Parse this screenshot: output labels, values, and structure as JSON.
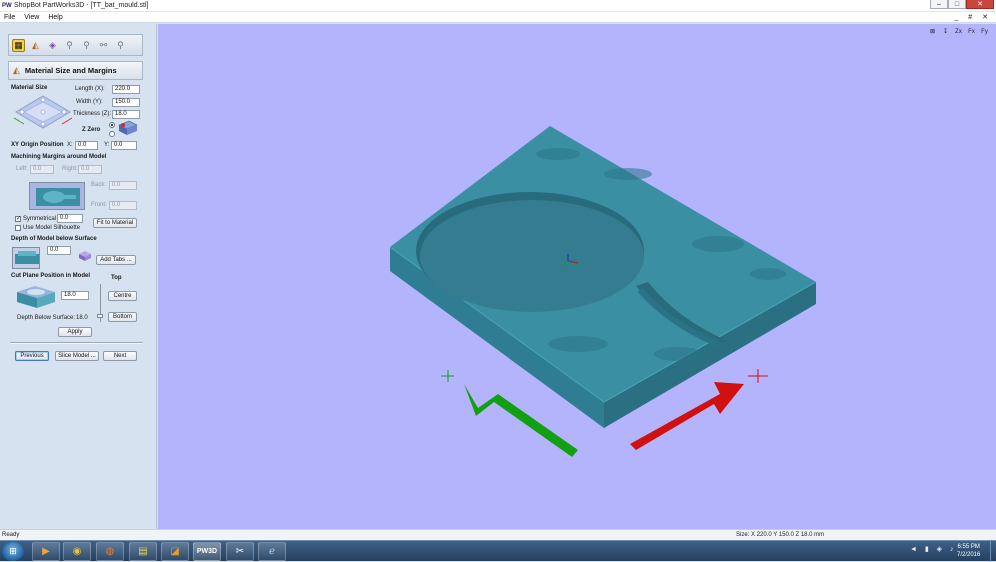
{
  "window": {
    "title": "ShopBot PartWorks3D - [TT_bat_mould.stl]",
    "app_icon": "pw3d-app-icon",
    "controls": [
      "–",
      "□",
      "✕"
    ]
  },
  "menu": {
    "items": [
      "File",
      "View",
      "Help"
    ],
    "mdi_controls": "_ # ✕"
  },
  "toolbar": {
    "icons": [
      "load-model-icon",
      "material-size-icon",
      "orient-model-icon",
      "toolpath-roughing-icon",
      "toolpath-finishing-icon",
      "preview-icon",
      "save-toolpath-icon"
    ]
  },
  "section": {
    "title": "Material Size and Margins",
    "icon": "material-size-icon"
  },
  "material_size": {
    "heading": "Material Size",
    "length_label": "Length (X):",
    "length_value": "220.0",
    "width_label": "Width (Y):",
    "width_value": "150.0",
    "thickness_label": "Thickness (Z):",
    "thickness_value": "18.0",
    "z_zero_label": "Z Zero"
  },
  "xy_origin": {
    "label": "XY Origin Position",
    "x_label": "X:",
    "x_value": "0.0",
    "y_label": "Y:",
    "y_value": "0.0"
  },
  "margins": {
    "heading": "Machining Margins around Model",
    "left_label": "Left:",
    "left_value": "0.0",
    "right_label": "Right:",
    "right_value": "0.0",
    "back_label": "Back:",
    "back_value": "0.0",
    "front_label": "Front:",
    "front_value": "0.0",
    "symmetrical_label": "Symmetrical",
    "symmetrical_checked": true,
    "symmetrical_value": "0.0",
    "use_silhouette_label": "Use Model Silhouette",
    "use_silhouette_checked": false,
    "fit_button": "Fit to Material"
  },
  "depth": {
    "heading": "Depth of Model below Surface",
    "value": "0.0",
    "add_tabs_button": "Add Tabs ..."
  },
  "cut_plane": {
    "heading": "Cut Plane Position in Model",
    "top_label": "Top",
    "value": "18.0",
    "centre_button": "Centre",
    "bottom_button": "Bottom",
    "depth_label": "Depth Below Surface:",
    "depth_value": "18.0",
    "apply_button": "Apply"
  },
  "nav": {
    "previous": "Previous",
    "slice": "Slice Model ...",
    "next": "Next"
  },
  "viewport": {
    "background": "#b4b4fd",
    "block_color": "#3a8fa3",
    "x_arrow_color": "#d11010",
    "y_arrow_color": "#12a012",
    "view_icons": [
      "iso-view-icon",
      "view-z-icon",
      "view-x-icon",
      "view-y-icon"
    ],
    "view_labels": [
      "⊠",
      "↧",
      "Zx",
      "Fx",
      "Fy"
    ]
  },
  "status": {
    "left": "Ready",
    "right": "Size: X 220.0 Y 150.0 Z 18.0 mm"
  },
  "taskbar": {
    "apps": [
      "media-player-icon",
      "chrome-icon",
      "firefox-icon",
      "file-explorer-icon",
      "partworks-icon",
      "pw3d-icon",
      "cutting-icon",
      "ie-icon"
    ],
    "app_glyphs": [
      "▶",
      "◉",
      "◍",
      "▤",
      "◪",
      "PW3D",
      "✂",
      "ℯ"
    ],
    "tray": "◄ ▮ ◈ ♪",
    "time": "6:55 PM",
    "date": "7/2/2016"
  }
}
